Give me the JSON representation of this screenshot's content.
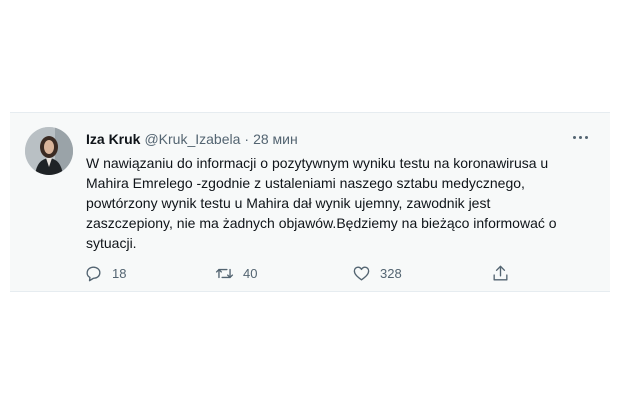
{
  "tweet": {
    "display_name": "Iza Kruk",
    "handle": "@Kruk_Izabela",
    "separator": "·",
    "timestamp": "28 мин",
    "text_lines": [
      "W nawiązaniu do informacji o pozytywnym wyniku testu na koronawirusa u",
      "Mahira Emrelego -zgodnie z ustaleniami naszego sztabu medycznego,",
      "powtórzony wynik testu u Mahira dał wynik ujemny, zawodnik jest",
      "zaszczepiony, nie ma żadnych objawów.Będziemy na bieżąco informować o",
      "sytuacji."
    ],
    "actions": {
      "reply_count": "18",
      "retweet_count": "40",
      "like_count": "328"
    }
  },
  "icons": {
    "more": "more-horizontal-icon",
    "reply": "reply-icon",
    "retweet": "retweet-icon",
    "like": "heart-icon",
    "share": "share-icon"
  },
  "colors": {
    "card_background": "#f7f9f9",
    "text_primary": "#0f1419",
    "text_secondary": "#536471"
  }
}
